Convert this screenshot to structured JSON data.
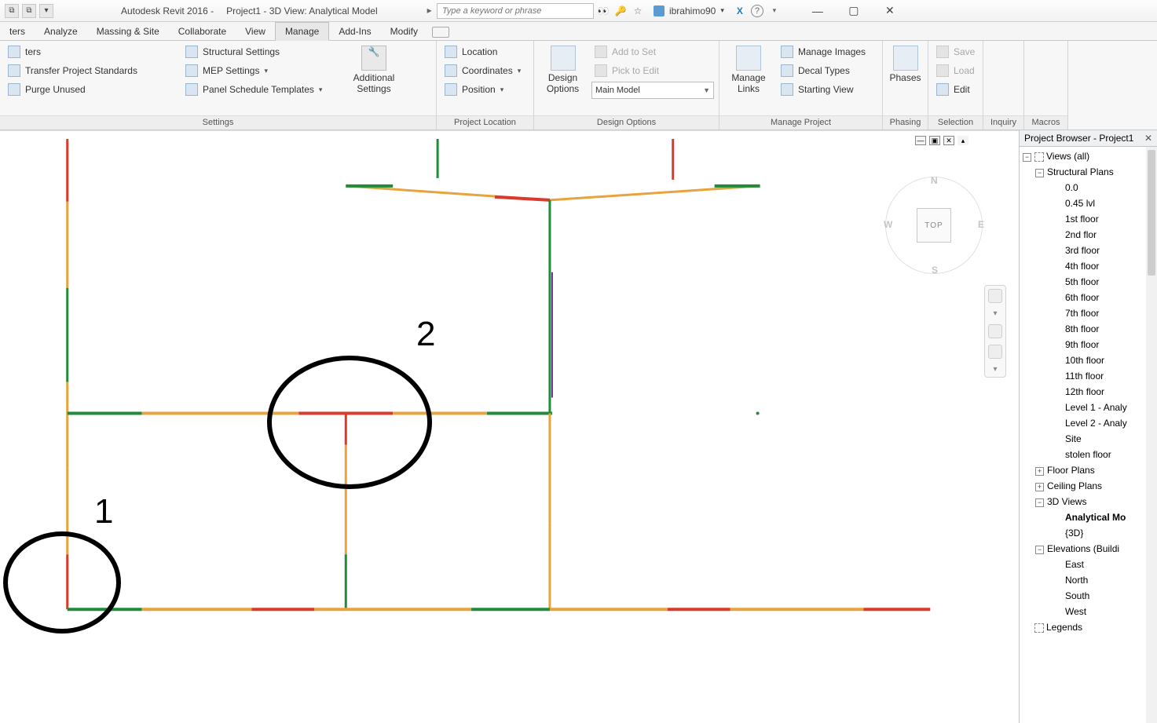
{
  "titlebar": {
    "app": "Autodesk Revit 2016 -",
    "doc": "Project1 - 3D View: Analytical Model",
    "search_placeholder": "Type a keyword or phrase",
    "username": "ibrahimo90"
  },
  "tabs": {
    "items": [
      "ters",
      "Analyze",
      "Massing & Site",
      "Collaborate",
      "View",
      "Manage",
      "Add-Ins",
      "Modify"
    ],
    "active_index": 5
  },
  "ribbon": {
    "settings": {
      "transfer": "Transfer  Project Standards",
      "purge": "Purge  Unused",
      "x": "ters",
      "structural": "Structural  Settings",
      "mep": "MEP  Settings",
      "panel_sched": "Panel Schedule  Templates",
      "additional": "Additional Settings",
      "label": "Settings"
    },
    "location": {
      "loc": "Location",
      "coords": "Coordinates",
      "pos": "Position",
      "label": "Project Location"
    },
    "design": {
      "design_options": "Design Options",
      "add_to_set": "Add to Set",
      "pick_to_edit": "Pick to Edit",
      "main_model": "Main Model",
      "label": "Design Options"
    },
    "project": {
      "manage_links": "Manage Links",
      "manage_images": "Manage  Images",
      "decal_types": "Decal  Types",
      "starting_view": "Starting  View",
      "label": "Manage Project"
    },
    "phasing": {
      "phases": "Phases",
      "label": "Phasing"
    },
    "selection": {
      "save": "Save",
      "load": "Load",
      "edit": "Edit",
      "label": "Selection"
    },
    "inquiry": {
      "label": "Inquiry"
    },
    "macros": {
      "label": "Macros"
    }
  },
  "viewcube": {
    "top": "TOP",
    "n": "N",
    "s": "S",
    "e": "E",
    "w": "W"
  },
  "annotations": {
    "one": "1",
    "two": "2"
  },
  "browser": {
    "title": "Project Browser - Project1",
    "views": "Views (all)",
    "structural_plans": "Structural Plans",
    "sp_items": [
      "0.0",
      "0.45 lvl",
      "1st floor",
      "2nd flor",
      "3rd floor",
      "4th floor",
      "5th floor",
      "6th floor",
      "7th floor",
      "8th floor",
      "9th floor",
      "10th floor",
      "11th floor",
      "12th floor",
      "Level 1 - Analy",
      "Level 2 - Analy",
      "Site",
      "stolen floor"
    ],
    "floor_plans": "Floor Plans",
    "ceiling_plans": "Ceiling Plans",
    "td_views": "3D Views",
    "td_items": [
      "Analytical Mo",
      "{3D}"
    ],
    "elevations": "Elevations (Buildi",
    "el_items": [
      "East",
      "North",
      "South",
      "West"
    ],
    "legends": "Legends"
  }
}
